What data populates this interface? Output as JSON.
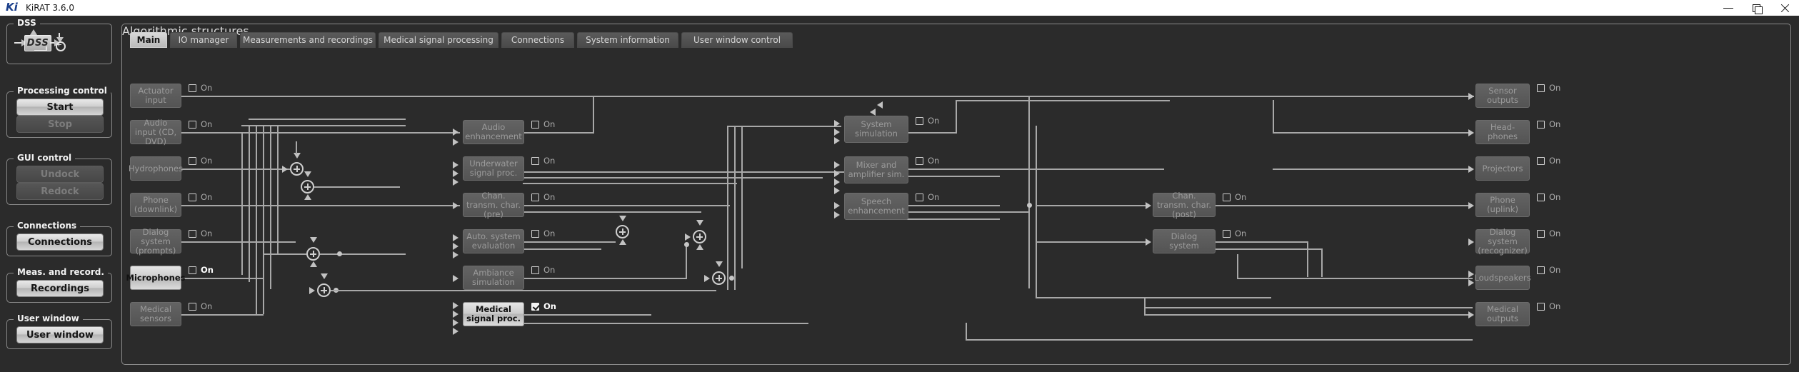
{
  "window": {
    "logo": "Ki",
    "title": "KiRAT 3.6.0",
    "minimize_icon": "minimize-icon",
    "restore_icon": "restore-icon",
    "close_icon": "close-icon"
  },
  "sidebar": {
    "groups": [
      {
        "title": "DSS",
        "dss_label": "DSS",
        "buttons": []
      },
      {
        "title": "Processing control",
        "buttons": [
          {
            "label": "Start",
            "state": "enabled"
          },
          {
            "label": "Stop",
            "state": "disabled"
          }
        ]
      },
      {
        "title": "GUI control",
        "buttons": [
          {
            "label": "Undock",
            "state": "disabled"
          },
          {
            "label": "Redock",
            "state": "disabled"
          }
        ]
      },
      {
        "title": "Connections",
        "buttons": [
          {
            "label": "Connections",
            "state": "enabled"
          }
        ]
      },
      {
        "title": "Meas. and record.",
        "buttons": [
          {
            "label": "Recordings",
            "state": "enabled"
          }
        ]
      },
      {
        "title": "User window",
        "buttons": [
          {
            "label": "User window",
            "state": "enabled"
          }
        ]
      }
    ]
  },
  "panel": {
    "title": "Algorithmic structures",
    "tabs": [
      {
        "label": "Main",
        "active": true
      },
      {
        "label": "IO manager",
        "active": false
      },
      {
        "label": "Measurements and recordings",
        "active": false
      },
      {
        "label": "Medical signal processing",
        "active": false
      },
      {
        "label": "Connections",
        "active": false
      },
      {
        "label": "System information",
        "active": false
      },
      {
        "label": "User window control",
        "active": false
      }
    ],
    "checkbox_label": "On"
  },
  "diagram": {
    "columns": {
      "inputs": [
        {
          "label": "Actuator input",
          "active": false,
          "checked": false
        },
        {
          "label": "Audio input (CD, DVD)",
          "active": false,
          "checked": false
        },
        {
          "label": "Hydrophones",
          "active": false,
          "checked": false
        },
        {
          "label": "Phone (downlink)",
          "active": false,
          "checked": false
        },
        {
          "label": "Dialog system (prompts)",
          "active": false,
          "checked": false
        },
        {
          "label": "Microphones",
          "active": true,
          "checked": false
        },
        {
          "label": "Medical sensors",
          "active": false,
          "checked": false
        }
      ],
      "stage1": [
        {
          "label": "Audio enhancement",
          "active": false,
          "checked": false
        },
        {
          "label": "Underwater signal proc.",
          "active": false,
          "checked": false
        },
        {
          "label": "Chan. transm. char. (pre)",
          "active": false,
          "checked": false
        },
        {
          "label": "Auto. system evaluation",
          "active": false,
          "checked": false
        },
        {
          "label": "Ambiance simulation",
          "active": false,
          "checked": false
        },
        {
          "label": "Medical signal proc.",
          "active": true,
          "checked": true
        }
      ],
      "stage2": [
        {
          "label": "System simulation",
          "active": false,
          "checked": false
        },
        {
          "label": "Mixer and amplifier sim.",
          "active": false,
          "checked": false
        },
        {
          "label": "Speech enhancement",
          "active": false,
          "checked": false
        }
      ],
      "stage3": [
        {
          "label": "Chan. transm. char. (post)",
          "active": false,
          "checked": false
        },
        {
          "label": "Dialog system",
          "active": false,
          "checked": false
        }
      ],
      "outputs": [
        {
          "label": "Sensor outputs",
          "active": false,
          "checked": false
        },
        {
          "label": "Head-phones",
          "active": false,
          "checked": false
        },
        {
          "label": "Projectors",
          "active": false,
          "checked": false
        },
        {
          "label": "Phone (uplink)",
          "active": false,
          "checked": false
        },
        {
          "label": "Dialog system (recognizer)",
          "active": false,
          "checked": false
        },
        {
          "label": "Loudspeakers",
          "active": false,
          "checked": false
        },
        {
          "label": "Medical outputs",
          "active": false,
          "checked": false
        }
      ]
    }
  },
  "colors": {
    "background": "#2b2b2b",
    "wire": "#a8a8a8",
    "accent_active": "#ffffff",
    "titlebar": "#ffffff"
  }
}
